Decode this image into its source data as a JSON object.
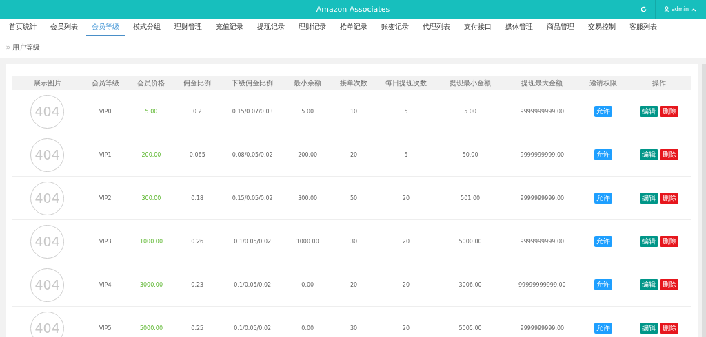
{
  "topbar": {
    "title": "Amazon Associates",
    "user": "admin"
  },
  "nav": [
    {
      "label": "首页统计",
      "selected": false
    },
    {
      "label": "会员列表",
      "selected": false
    },
    {
      "label": "会员等级",
      "selected": true
    },
    {
      "label": "模式分组",
      "selected": false
    },
    {
      "label": "理财管理",
      "selected": false
    },
    {
      "label": "充值记录",
      "selected": false
    },
    {
      "label": "提现记录",
      "selected": false
    },
    {
      "label": "理财记录",
      "selected": false
    },
    {
      "label": "抢单记录",
      "selected": false
    },
    {
      "label": "账变记录",
      "selected": false
    },
    {
      "label": "代理列表",
      "selected": false
    },
    {
      "label": "支付接口",
      "selected": false
    },
    {
      "label": "媒体管理",
      "selected": false
    },
    {
      "label": "商品管理",
      "selected": false
    },
    {
      "label": "交易控制",
      "selected": false
    },
    {
      "label": "客服列表",
      "selected": false
    }
  ],
  "breadcrumb": "用户等级",
  "table": {
    "columns": [
      "展示图片",
      "会员等级",
      "会员价格",
      "佣金比例",
      "下级佣金比例",
      "最小余额",
      "接单次数",
      "每日提现次数",
      "提现最小金额",
      "提现最大金额",
      "邀请权限",
      "操作"
    ],
    "rows": [
      {
        "image": "404",
        "level": "VIP0",
        "price": "5.00",
        "commission": "0.2",
        "sub_commission": "0.15/0.07/0.03",
        "min_balance": "5.00",
        "orders": "10",
        "daily_withdrawals": "5",
        "withdraw_min": "5.00",
        "withdraw_max": "9999999999.00",
        "invite": "允许",
        "actions": [
          "编辑",
          "删除"
        ]
      },
      {
        "image": "404",
        "level": "VIP1",
        "price": "200.00",
        "commission": "0.065",
        "sub_commission": "0.08/0.05/0.02",
        "min_balance": "200.00",
        "orders": "20",
        "daily_withdrawals": "5",
        "withdraw_min": "50.00",
        "withdraw_max": "9999999999.00",
        "invite": "允许",
        "actions": [
          "编辑",
          "删除"
        ]
      },
      {
        "image": "404",
        "level": "VIP2",
        "price": "300.00",
        "commission": "0.18",
        "sub_commission": "0.15/0.05/0.02",
        "min_balance": "300.00",
        "orders": "50",
        "daily_withdrawals": "20",
        "withdraw_min": "501.00",
        "withdraw_max": "9999999999.00",
        "invite": "允许",
        "actions": [
          "编辑",
          "删除"
        ]
      },
      {
        "image": "404",
        "level": "VIP3",
        "price": "1000.00",
        "commission": "0.26",
        "sub_commission": "0.1/0.05/0.02",
        "min_balance": "1000.00",
        "orders": "30",
        "daily_withdrawals": "20",
        "withdraw_min": "5000.00",
        "withdraw_max": "9999999999.00",
        "invite": "允许",
        "actions": [
          "编辑",
          "删除"
        ]
      },
      {
        "image": "404",
        "level": "VIP4",
        "price": "3000.00",
        "commission": "0.23",
        "sub_commission": "0.1/0.05/0.02",
        "min_balance": "0.00",
        "orders": "20",
        "daily_withdrawals": "20",
        "withdraw_min": "3006.00",
        "withdraw_max": "99999999999.00",
        "invite": "允许",
        "actions": [
          "编辑",
          "删除"
        ]
      },
      {
        "image": "404",
        "level": "VIP5",
        "price": "5000.00",
        "commission": "0.25",
        "sub_commission": "0.1/0.05/0.02",
        "min_balance": "0.00",
        "orders": "30",
        "daily_withdrawals": "20",
        "withdraw_min": "5005.00",
        "withdraw_max": "9999999999.00",
        "invite": "允许",
        "actions": [
          "编辑",
          "删除"
        ]
      }
    ]
  }
}
